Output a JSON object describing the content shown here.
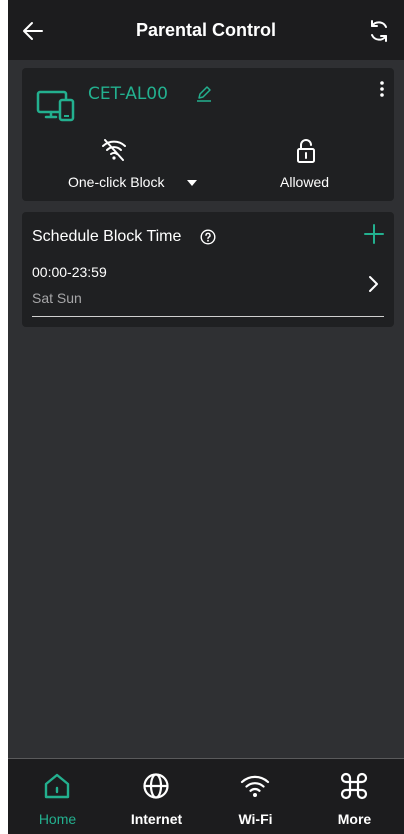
{
  "header": {
    "title": "Parental Control",
    "back_icon": "back-arrow-icon",
    "refresh_icon": "refresh-icon"
  },
  "device": {
    "name": "CET-AL00",
    "device_icon": "devices-icon",
    "edit_icon": "edit-pencil-icon",
    "more_icon": "more-vertical-icon",
    "block_label": "One-click Block",
    "block_icon": "wifi-off-icon",
    "status_label": "Allowed",
    "status_icon": "unlock-icon"
  },
  "schedule": {
    "title": "Schedule Block Time",
    "help_icon": "help-circle-icon",
    "add_icon": "plus-icon",
    "items": [
      {
        "time": "00:00-23:59",
        "days": "Sat Sun"
      }
    ]
  },
  "tabbar": {
    "tabs": [
      {
        "label": "Home",
        "icon": "home-icon",
        "active": true
      },
      {
        "label": "Internet",
        "icon": "globe-icon",
        "active": false
      },
      {
        "label": "Wi-Fi",
        "icon": "wifi-icon",
        "active": false
      },
      {
        "label": "More",
        "icon": "command-icon",
        "active": false
      }
    ]
  },
  "colors": {
    "accent": "#23b08f",
    "background": "#2f3033",
    "card": "#1f2022",
    "header": "#1c1c1e"
  }
}
